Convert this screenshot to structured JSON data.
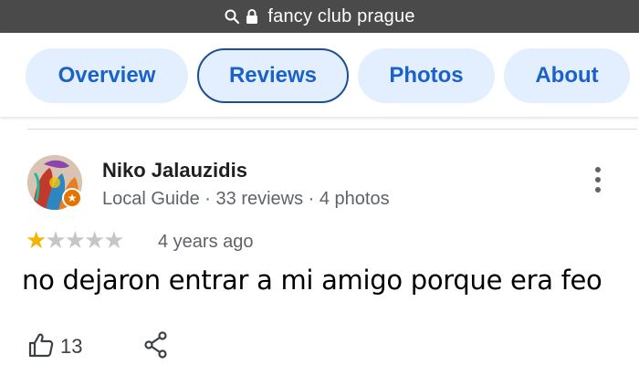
{
  "browser": {
    "url_text": "fancy club prague",
    "icons": [
      "search-icon",
      "lock-icon"
    ]
  },
  "tabs": [
    {
      "label": "Overview",
      "selected": false
    },
    {
      "label": "Reviews",
      "selected": true
    },
    {
      "label": "Photos",
      "selected": false
    },
    {
      "label": "About",
      "selected": false
    }
  ],
  "review": {
    "author_name": "Niko Jalauzidis",
    "author_meta": "Local Guide · 33 reviews · 4 photos",
    "rating": 1,
    "rating_max": 5,
    "time_ago": "4 years ago",
    "text": "no dejaron entrar a mi amigo porque era feo",
    "likes": "13"
  },
  "colors": {
    "tab_bg": "#e3efff",
    "tab_text": "#1a62c7",
    "star_on": "#f4b400",
    "star_off": "#c6c6c6",
    "guide_badge": "#e37400"
  }
}
